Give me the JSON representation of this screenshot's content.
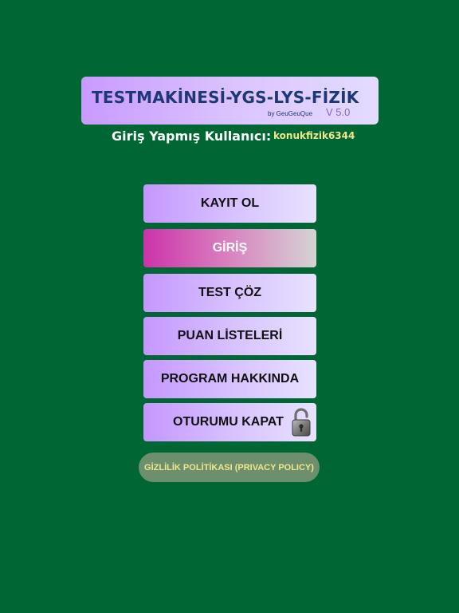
{
  "header": {
    "title": "TESTMAKİNESİ-YGS-LYS-FİZİK",
    "byline": "by GeuGeuQue",
    "version": "V 5.0"
  },
  "user": {
    "label": "Giriş Yapmış Kullanıcı:",
    "name": "konukfizik6344"
  },
  "menu": {
    "register": "KAYIT OL",
    "login": "GİRİŞ",
    "solve_test": "TEST ÇÖZ",
    "score_lists": "PUAN LİSTELERİ",
    "about": "PROGRAM HAKKINDA",
    "logout": "OTURUMU KAPAT"
  },
  "icons": {
    "logout": "padlock-icon"
  },
  "privacy": {
    "label": "GİZLİLİK POLİTİKASI (PRIVACY POLICY)"
  },
  "colors": {
    "background": "#006633",
    "title_text": "#1e3777",
    "username_text": "#f0e68c",
    "active_button": "#cc33aa"
  }
}
